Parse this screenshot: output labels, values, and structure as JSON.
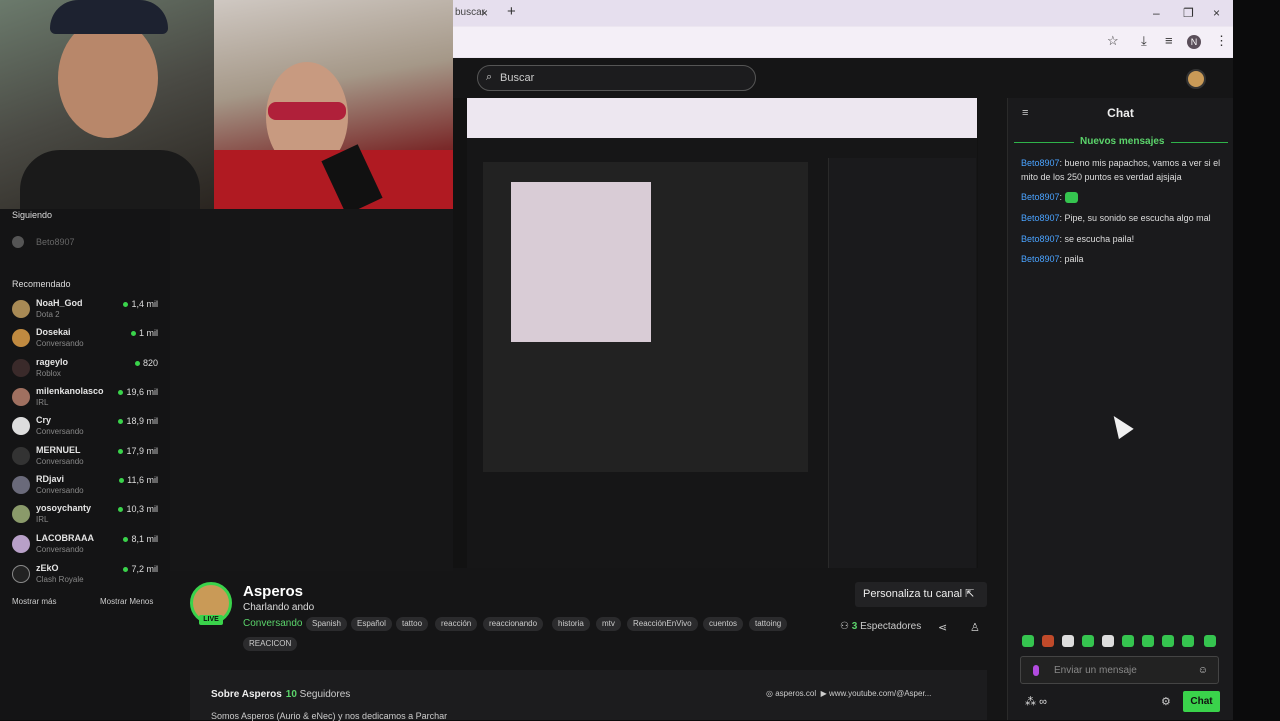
{
  "browser": {
    "tab_title": "buscar co",
    "tab_close": "×",
    "new_tab": "+",
    "window_buttons": [
      "–",
      "❐",
      "×"
    ],
    "profile_initial": "N"
  },
  "header": {
    "search_placeholder": "Buscar"
  },
  "sidebar": {
    "following_title": "Siguiendo",
    "following": [
      {
        "name": "Beto8907"
      }
    ],
    "recommended_title": "Recomendado",
    "recommended": [
      {
        "name": "NoaH_God",
        "sub": "Dota 2",
        "count": "1,4 mil",
        "color": "#a88a55"
      },
      {
        "name": "Dosekai",
        "sub": "Conversando",
        "count": "1 mil",
        "color": "#c08a40"
      },
      {
        "name": "rageylo",
        "sub": "Roblox",
        "count": "820",
        "color": "#3a2a2a"
      },
      {
        "name": "milenkanolasco",
        "sub": "IRL",
        "count": "19,6 mil",
        "color": "#a07060"
      },
      {
        "name": "Cry",
        "sub": "Conversando",
        "count": "18,9 mil",
        "color": "#ddd"
      },
      {
        "name": "MERNUEL",
        "sub": "Conversando",
        "count": "17,9 mil",
        "color": "#333"
      },
      {
        "name": "RDjavi",
        "sub": "Conversando",
        "count": "11,6 mil",
        "color": "#6a6a7a"
      },
      {
        "name": "yosoychanty",
        "sub": "IRL",
        "count": "10,3 mil",
        "color": "#8a9a6a"
      },
      {
        "name": "LACOBRAAA",
        "sub": "Conversando",
        "count": "8,1 mil",
        "color": "#b8a0c8"
      },
      {
        "name": "zEkO",
        "sub": "Clash Royale",
        "count": "7,2 mil",
        "color": "#222"
      }
    ],
    "show_more": "Mostrar más",
    "show_less": "Mostrar Menos"
  },
  "chat": {
    "title": "Chat",
    "new_messages": "Nuevos mensajes",
    "messages": [
      {
        "user": "Beto8907",
        "text": ": bueno mis papachos, vamos a ver si el mito de los 250 puntos es verdad ajsjaja"
      },
      {
        "user": "Beto8907",
        "text": ": "
      },
      {
        "user": "Beto8907",
        "text": ": Pipe, su sonido se escucha algo mal"
      },
      {
        "user": "Beto8907",
        "text": ": se escucha paila!"
      },
      {
        "user": "Beto8907",
        "text": ": paila"
      }
    ],
    "input_placeholder": "Enviar un mensaje",
    "send_button": "Chat",
    "points": "∞"
  },
  "channel": {
    "name": "Asperos",
    "live_badge": "LIVE",
    "subtitle": "Charlando ando",
    "category": "Conversando",
    "tags": [
      "Spanish",
      "Español",
      "tattoo",
      "reacción",
      "reaccionando",
      "historia",
      "mtv",
      "ReacciónEnVivo",
      "cuentos",
      "tattoing",
      "REACICON"
    ],
    "customize_button": "Personaliza tu canal",
    "viewers_count": "3",
    "viewers_label": "Espectadores",
    "about_title": "Sobre Asperos",
    "followers_count": "10",
    "followers_label": "Seguidores",
    "about_text": "Somos Asperos (Aurio & eNec) y nos dedicamos a Parchar",
    "links": [
      "asperos.col",
      "www.youtube.com/@Asper..."
    ]
  },
  "colors": {
    "accent": "#3ad34b",
    "username": "#4aa3ff",
    "background": "#151516"
  }
}
